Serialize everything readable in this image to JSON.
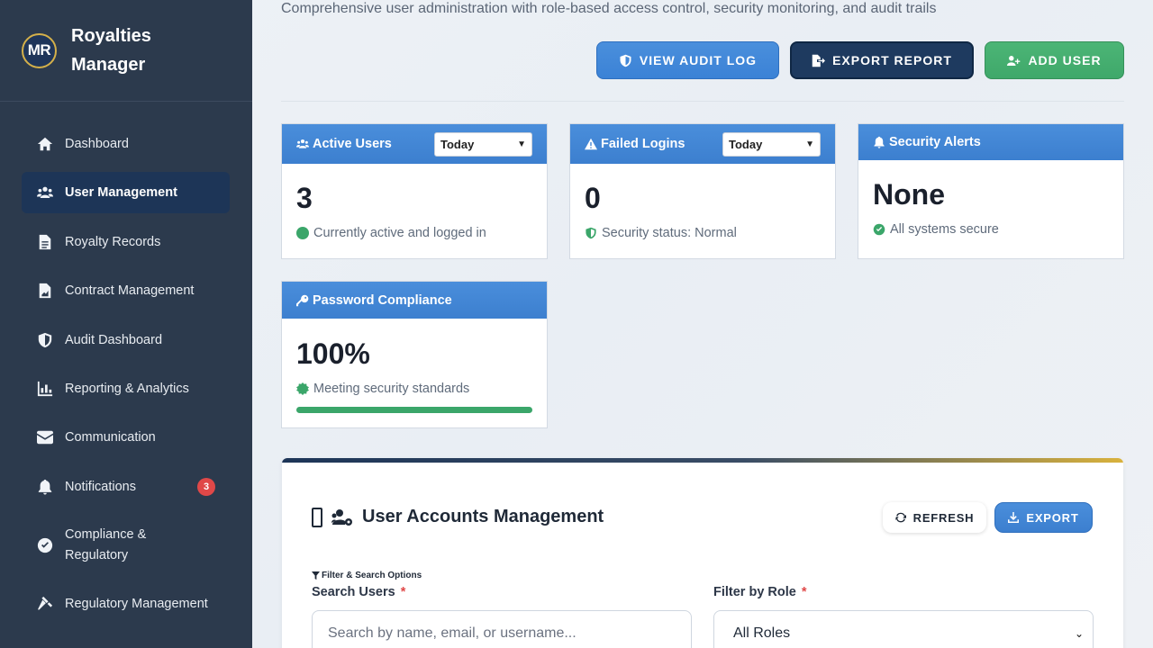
{
  "brand": {
    "logo": "MR",
    "name_line1": "Royalties",
    "name_line2": "Manager"
  },
  "nav": [
    {
      "label": "Dashboard",
      "icon": "home-icon"
    },
    {
      "label": "User Management",
      "icon": "users-icon",
      "active": true
    },
    {
      "label": "Royalty Records",
      "icon": "file-icon"
    },
    {
      "label": "Contract Management",
      "icon": "contract-icon"
    },
    {
      "label": "Audit Dashboard",
      "icon": "shield-icon"
    },
    {
      "label": "Reporting & Analytics",
      "icon": "chart-icon"
    },
    {
      "label": "Communication",
      "icon": "envelope-icon"
    },
    {
      "label": "Notifications",
      "icon": "bell-icon",
      "badge": "3"
    },
    {
      "label_line1": "Compliance &",
      "label_line2": "Regulatory",
      "icon": "check-circle-icon"
    },
    {
      "label": "Regulatory Management",
      "icon": "gavel-icon"
    }
  ],
  "header": {
    "subtitle": "Comprehensive user administration with role-based access control, security monitoring, and audit trails",
    "view_audit_log": "View Audit Log",
    "export_report": "Export Report",
    "add_user": "Add User"
  },
  "cards": {
    "active_users": {
      "title": "Active Users",
      "filter": "Today",
      "value": "3",
      "note": "Currently active and logged in"
    },
    "failed_logins": {
      "title": "Failed Logins",
      "filter": "Today",
      "value": "0",
      "note": "Security status: Normal"
    },
    "security_alerts": {
      "title": "Security Alerts",
      "value": "None",
      "note": "All systems secure"
    },
    "password_compliance": {
      "title": "Password Compliance",
      "value": "100%",
      "note": "Meeting security standards",
      "progress": 1.0
    }
  },
  "users_panel": {
    "title": "User Accounts Management",
    "refresh": "Refresh",
    "export": "Export",
    "filter_caption": "Filter & Search Options",
    "search_label": "Search Users",
    "search_placeholder": "Search by name, email, or username...",
    "role_label": "Filter by Role",
    "role_value": "All Roles",
    "required_mark": "*"
  },
  "colors": {
    "sidebar": "#2c3a4d",
    "accent_blue": "#3c7fcf",
    "navy": "#1e3a5f",
    "green": "#3fa86a",
    "badge_red": "#e04848",
    "gold": "#d4b04a"
  }
}
